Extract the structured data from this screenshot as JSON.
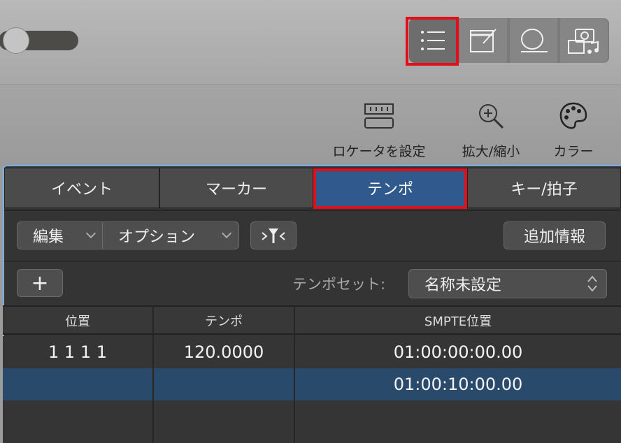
{
  "toolbar": {
    "views": [
      {
        "icon": "list-icon",
        "selected": true
      },
      {
        "icon": "note-pad-icon",
        "selected": false
      },
      {
        "icon": "loop-icon",
        "selected": false
      },
      {
        "icon": "media-browser-icon",
        "selected": false
      }
    ]
  },
  "subtoolbar": {
    "set_locators": "ロケータを設定",
    "zoom": "拡大/縮小",
    "color": "カラー"
  },
  "tabs": [
    {
      "label": "イベント"
    },
    {
      "label": "マーカー"
    },
    {
      "label": "テンポ"
    },
    {
      "label": "キー/拍子"
    }
  ],
  "controls": {
    "edit": "編集",
    "options": "オプション",
    "filter_icon": "filter-icon",
    "additional_info": "追加情報",
    "add": "+",
    "tempo_set_label": "テンポセット:",
    "tempo_set_value": "名称未設定"
  },
  "table": {
    "columns": [
      "位置",
      "テンポ",
      "SMPTE位置"
    ],
    "rows": [
      {
        "position": "1  1  1      1",
        "tempo": "120.0000",
        "smpte": "01:00:00:00.00",
        "selected": false
      },
      {
        "position": "",
        "tempo": "",
        "smpte": "01:00:10:00.00",
        "selected": true
      }
    ]
  },
  "colors": {
    "accent": "#305a8e",
    "highlight_box": "#e0101a",
    "panel_border": "#74b0f0"
  }
}
